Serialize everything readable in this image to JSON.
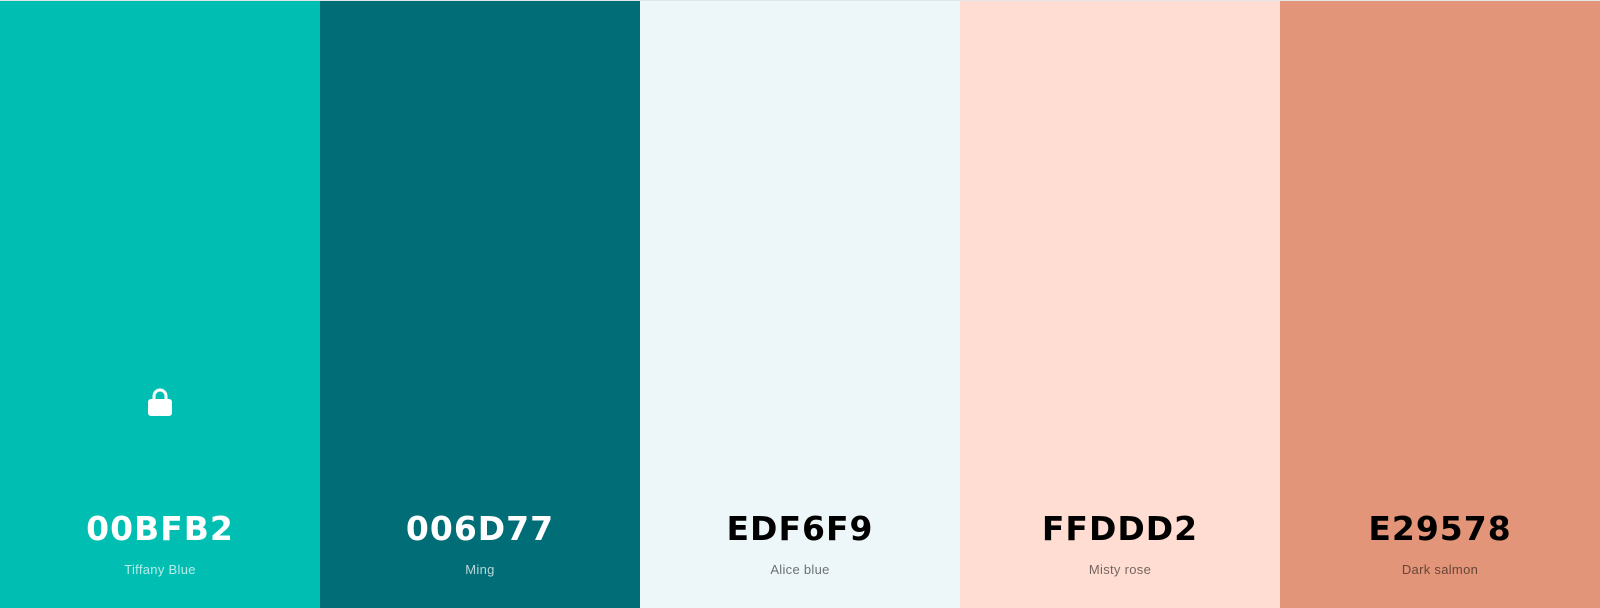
{
  "palette": {
    "swatches": [
      {
        "hex": "00BFB2",
        "name": "Tiffany Blue",
        "color": "#00BFB2",
        "text_tone": "light",
        "locked": true
      },
      {
        "hex": "006D77",
        "name": "Ming",
        "color": "#006D77",
        "text_tone": "light",
        "locked": false
      },
      {
        "hex": "EDF6F9",
        "name": "Alice blue",
        "color": "#EDF6F9",
        "text_tone": "dark",
        "locked": false
      },
      {
        "hex": "FFDDD2",
        "name": "Misty rose",
        "color": "#FFDDD2",
        "text_tone": "dark",
        "locked": false
      },
      {
        "hex": "E29578",
        "name": "Dark salmon",
        "color": "#E29578",
        "text_tone": "dark",
        "locked": false
      }
    ],
    "lock_icon": "lock-icon"
  }
}
